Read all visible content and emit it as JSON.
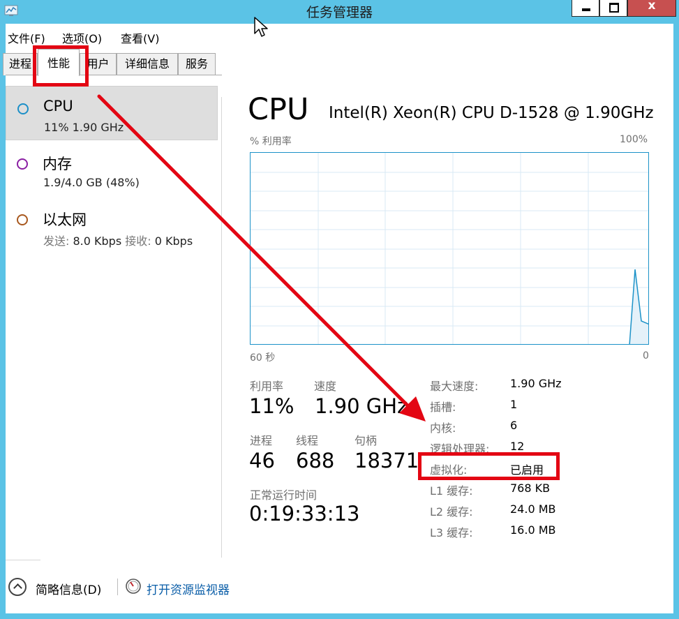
{
  "window": {
    "title": "任务管理器",
    "close_label": "x"
  },
  "menu": {
    "items": [
      "文件(F)",
      "选项(O)",
      "查看(V)"
    ]
  },
  "tabs": [
    "进程",
    "性能",
    "用户",
    "详细信息",
    "服务"
  ],
  "resources": [
    {
      "name": "CPU",
      "sub": "11% 1.90 GHz",
      "color": "#1b8fc7"
    },
    {
      "name": "内存",
      "sub": "1.9/4.0 GB (48%)",
      "color": "#8a1fa3"
    },
    {
      "name": "以太网",
      "sub_send_label": "发送:",
      "sub_send_value": "8.0 Kbps",
      "sub_recv_label": "接收:",
      "sub_recv_value": "0 Kbps",
      "color": "#a8581e"
    }
  ],
  "cpu": {
    "title": "CPU",
    "model": "Intel(R) Xeon(R) CPU D-1528 @ 1.90GHz",
    "graph": {
      "y_label": "% 利用率",
      "y_max_label": "100%",
      "x_left_label": "60 秒",
      "x_right_label": "0"
    },
    "stats": {
      "utilization_label": "利用率",
      "utilization_value": "11%",
      "speed_label": "速度",
      "speed_value": "1.90 GHz",
      "processes_label": "进程",
      "processes_value": "46",
      "threads_label": "线程",
      "threads_value": "688",
      "handles_label": "句柄",
      "handles_value": "18371",
      "uptime_label": "正常运行时间",
      "uptime_value": "0:19:33:13"
    },
    "specs": [
      {
        "key": "最大速度:",
        "value": "1.90 GHz"
      },
      {
        "key": "插槽:",
        "value": "1"
      },
      {
        "key": "内核:",
        "value": "6"
      },
      {
        "key": "逻辑处理器:",
        "value": "12"
      },
      {
        "key": "虚拟化:",
        "value": "已启用"
      },
      {
        "key": "L1 缓存:",
        "value": "768 KB"
      },
      {
        "key": "L2 缓存:",
        "value": "24.0 MB"
      },
      {
        "key": "L3 缓存:",
        "value": "16.0 MB"
      }
    ]
  },
  "footer": {
    "less_details": "简略信息(D)",
    "open_monitor": "打开资源监视器"
  },
  "colors": {
    "accent": "#1c92c8",
    "annotation": "#e30613",
    "titlebar": "#5bc3e6"
  }
}
